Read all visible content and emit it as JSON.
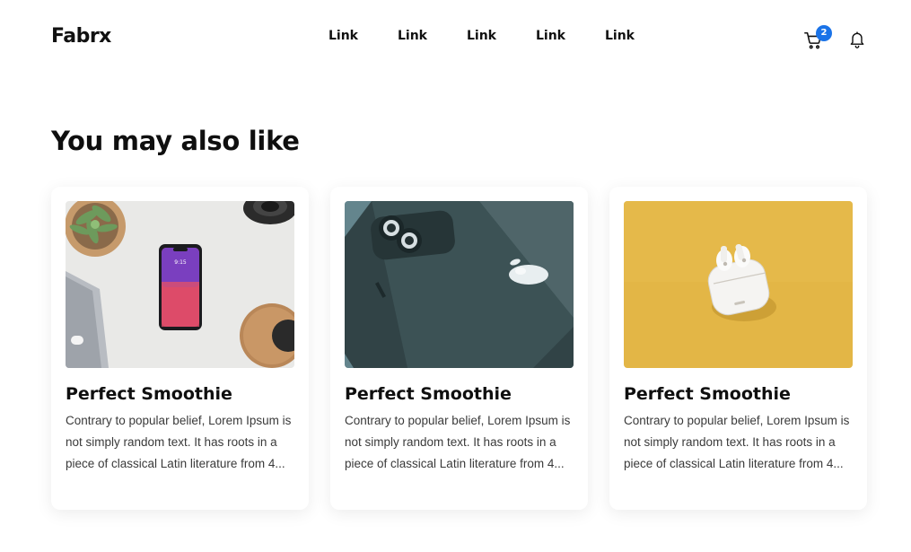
{
  "navbar": {
    "logo": "Fabrx",
    "links": [
      "Link",
      "Link",
      "Link",
      "Link",
      "Link"
    ],
    "cart_count": "2",
    "cart_icon": "cart-icon",
    "bell_icon": "bell-icon"
  },
  "section": {
    "title": "You may also like"
  },
  "cards": [
    {
      "title": "Perfect Smoothie",
      "text": "Contrary to popular belief, Lorem Ipsum is not simply random text. It has roots in a piece of classical Latin literature from 4...",
      "image": "phone-flatlay-photo"
    },
    {
      "title": "Perfect Smoothie",
      "text": "Contrary to popular belief, Lorem Ipsum is not simply random text. It has roots in a piece of classical Latin literature from 4...",
      "image": "iphone-back-photo"
    },
    {
      "title": "Perfect Smoothie",
      "text": "Contrary to popular belief, Lorem Ipsum is not simply random text. It has roots in a piece of classical Latin literature from 4...",
      "image": "airpods-photo"
    }
  ],
  "colors": {
    "badge": "#1a73e8",
    "text": "#0f0f0f",
    "body_text": "#3a3a3a"
  }
}
